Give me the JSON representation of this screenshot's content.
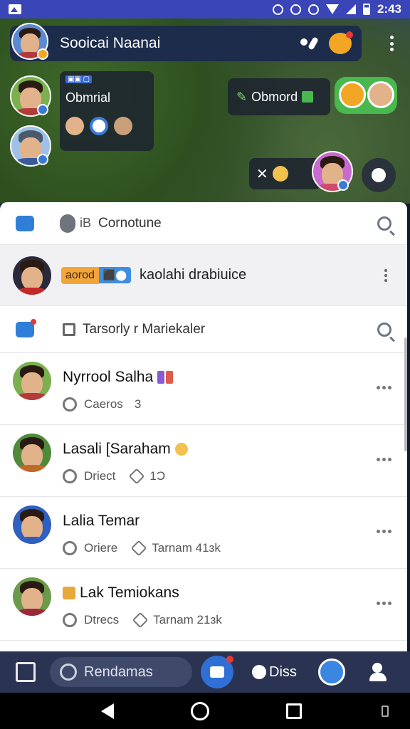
{
  "status_bar": {
    "time": "2:43"
  },
  "app_bar": {
    "title": "Sooicai Naanai"
  },
  "overlay": {
    "tag_small": "▣▣ ▢",
    "user_label": "Obmrial",
    "chat_chip": "Obmord",
    "reaction_sym": "✕"
  },
  "sections": [
    {
      "label": "Cornotune"
    },
    {
      "label": "Tarsorly r Mariekaler"
    }
  ],
  "highlight": {
    "pill_orange": "aorod",
    "pill_blue": "⬛⬤",
    "text": "kaolahi drabiuice",
    "side": "iB"
  },
  "contacts": [
    {
      "name": "Nyrrool Salha",
      "meta1": "Caeros",
      "meta2": "3",
      "accent": "#c63b5e"
    },
    {
      "name": "Lasali [Saraham",
      "meta1": "Driect",
      "meta2": "1Ɔ",
      "accent": "#f2a623"
    },
    {
      "name": "Lalia Temar",
      "meta1": "Oriere",
      "meta2": "Tarnam 41ɜk",
      "accent": "#3a7bd5"
    },
    {
      "name": "Lak Temiokans",
      "meta1": "Dtrecs",
      "meta2": "Tarnam 21ɜk",
      "accent": "#3a7bd5"
    }
  ],
  "bottom_nav": {
    "search_label": "Rendamas",
    "dm_label": "Diss"
  },
  "colors": {
    "primary": "#3a45b8",
    "app_bar": "#1c2c4a",
    "accent_blue": "#2f6fd6",
    "accent_orange": "#f2a623"
  }
}
